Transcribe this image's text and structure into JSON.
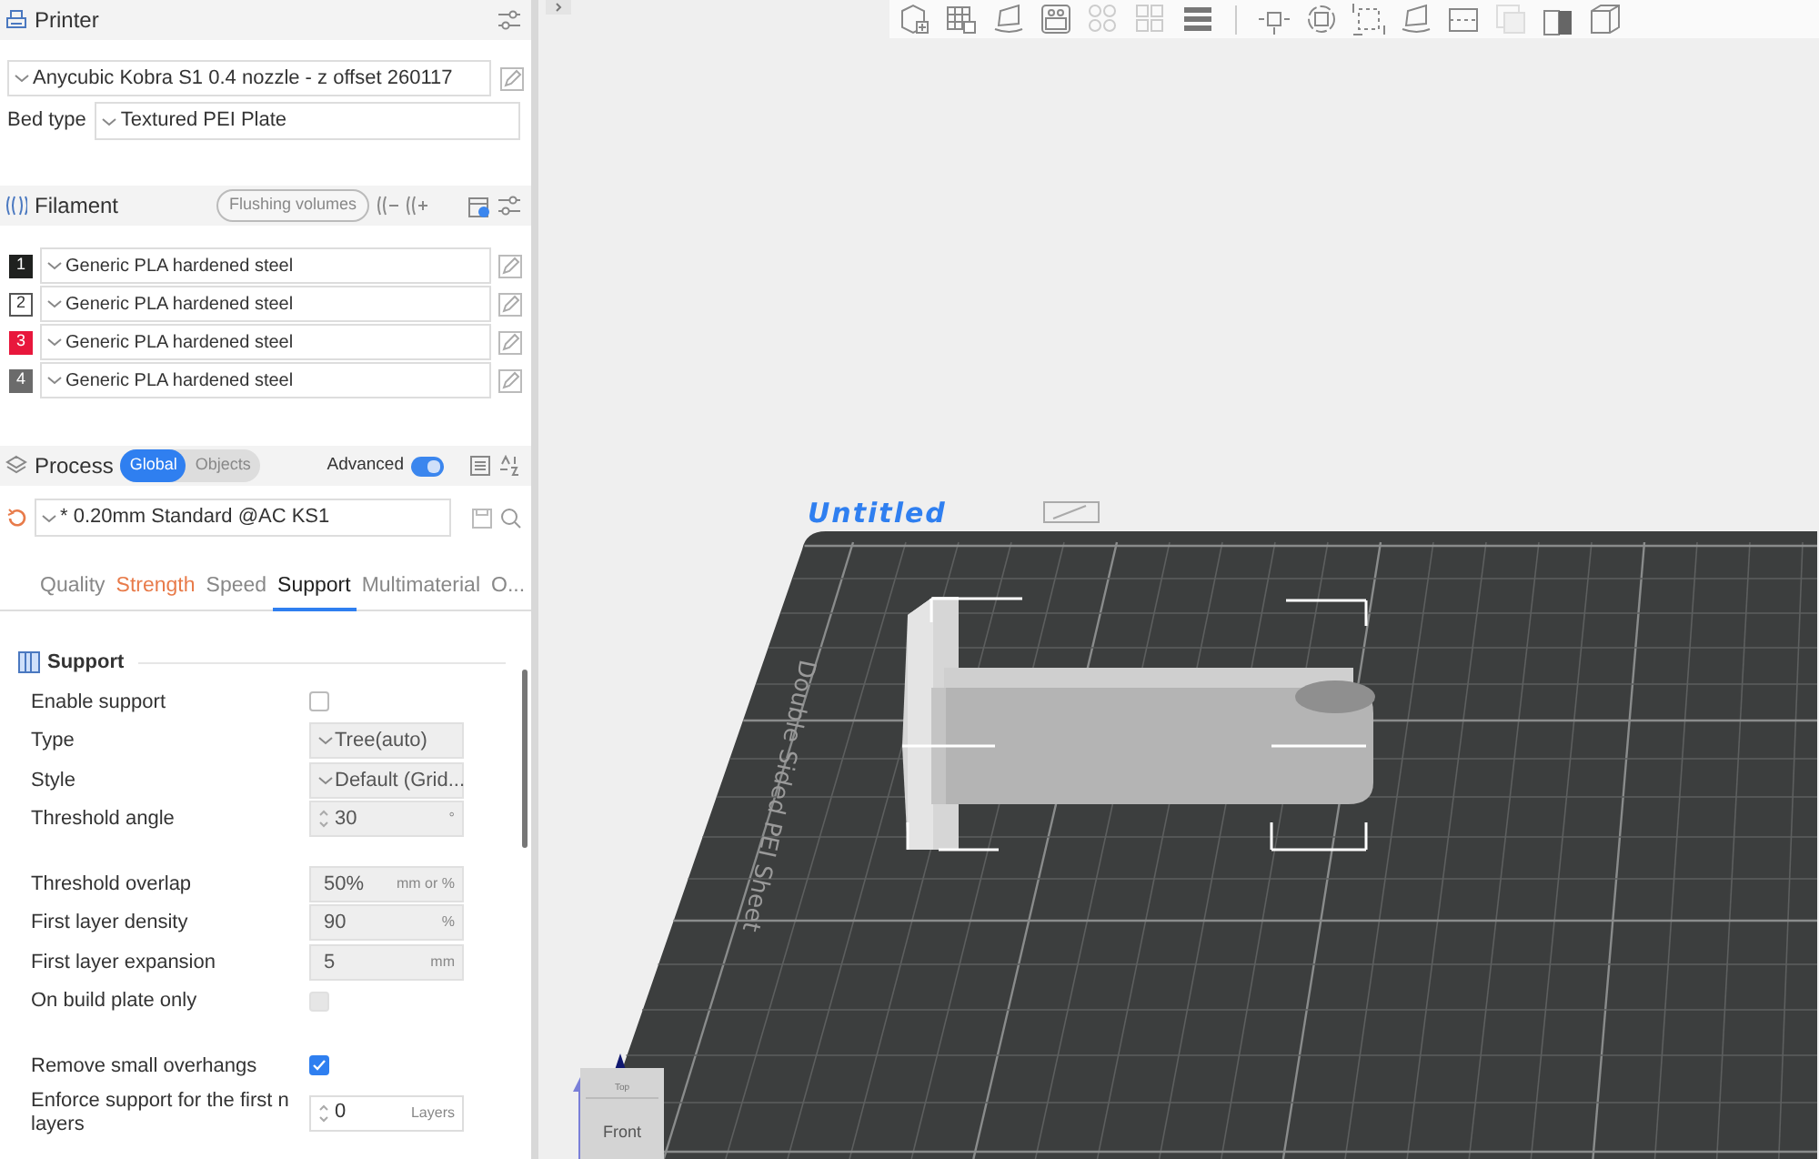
{
  "printer": {
    "title": "Printer",
    "preset": "Anycubic Kobra S1 0.4 nozzle - z offset 260117",
    "bed_type_label": "Bed type",
    "bed_type": "Textured PEI Plate"
  },
  "filament": {
    "title": "Filament",
    "flushing_button": "Flushing volumes",
    "items": [
      {
        "number": "1",
        "color": "#1f211f",
        "preset": "Generic PLA hardened steel"
      },
      {
        "number": "2",
        "color": "#ffffff",
        "preset": "Generic PLA hardened steel"
      },
      {
        "number": "3",
        "color": "#e8173c",
        "preset": "Generic PLA hardened steel"
      },
      {
        "number": "4",
        "color": "#6b6b6b",
        "preset": "Generic PLA hardened steel"
      }
    ]
  },
  "process": {
    "title": "Process",
    "scope": [
      {
        "label": "Global",
        "selected": true
      },
      {
        "label": "Objects",
        "selected": false
      }
    ],
    "advanced_label": "Advanced",
    "advanced_on": true,
    "preset": "* 0.20mm Standard @AC KS1",
    "tabs": [
      {
        "label": "Quality",
        "selected": false,
        "modified": false
      },
      {
        "label": "Strength",
        "selected": false,
        "modified": true
      },
      {
        "label": "Speed",
        "selected": false,
        "modified": false
      },
      {
        "label": "Support",
        "selected": true,
        "modified": false
      },
      {
        "label": "Multimaterial",
        "selected": false,
        "modified": false
      },
      {
        "label": "O...",
        "selected": false,
        "modified": false
      }
    ],
    "section_title": "Support",
    "setting_groups": [
      [
        {
          "kind": "checkbox",
          "label": "Enable support",
          "checked": false,
          "disabled": false
        },
        {
          "kind": "combo",
          "label": "Type",
          "value": "Tree(auto)",
          "disabled": true
        },
        {
          "kind": "combo",
          "label": "Style",
          "value": "Default (Grid...",
          "disabled": true
        },
        {
          "kind": "spin",
          "label": "Threshold angle",
          "value": "30",
          "unit": "°",
          "disabled": true
        }
      ],
      [
        {
          "kind": "number",
          "label": "Threshold overlap",
          "value": "50%",
          "unit": "mm or %",
          "disabled": true
        },
        {
          "kind": "number",
          "label": "First layer density",
          "value": "90",
          "unit": "%",
          "disabled": true
        },
        {
          "kind": "number",
          "label": "First layer expansion",
          "value": "5",
          "unit": "mm",
          "disabled": true
        },
        {
          "kind": "checkbox",
          "label": "On build plate only",
          "checked": false,
          "disabled": true
        }
      ],
      [
        {
          "kind": "checkbox",
          "label": "Remove small overhangs",
          "checked": true,
          "disabled": false
        },
        {
          "kind": "spin",
          "label": "Enforce support for the first n layers",
          "value": "0",
          "unit": "Layers",
          "disabled": false
        }
      ]
    ]
  },
  "viewport": {
    "plate_name": "Untitled",
    "sheet_label": "Double Sided PEI Sheet",
    "view_cube": {
      "top": "Top",
      "front": "Front"
    }
  }
}
